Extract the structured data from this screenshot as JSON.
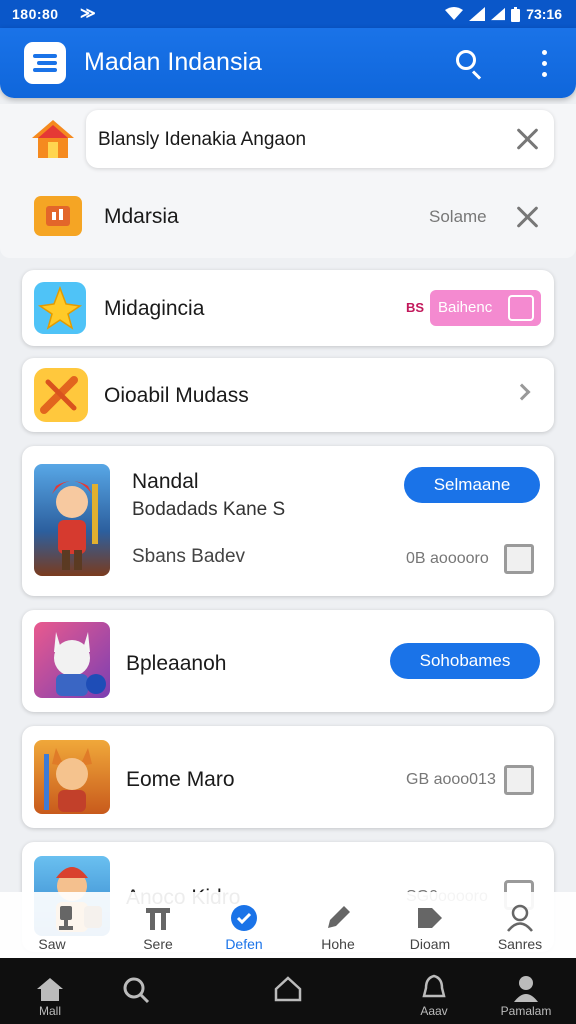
{
  "status_bar": {
    "time_left": "180:80",
    "time_right": "73:16"
  },
  "app_bar": {
    "title": "Madan Indansia"
  },
  "search_row": {
    "value": "Blansly  Idenakia Angaon"
  },
  "menu_rows": [
    {
      "label": "Mdarsia",
      "meta": "Solame"
    },
    {
      "label": "Midagincia",
      "badge_text": "Baihenc",
      "badge_prefix": "BS"
    },
    {
      "label": "Oioabil Mudass"
    }
  ],
  "game_cards": [
    {
      "title": "Nandal",
      "subtitle": "Bodadads Kane S",
      "extra": "Sbans Badev",
      "button": "Selmaane",
      "meta": "0B aooooro"
    },
    {
      "title": "Bpleaanoh",
      "button": "Sohobames"
    },
    {
      "title": "Eome Maro",
      "meta": "GB aooo013"
    },
    {
      "title": "Anoco Kidro",
      "meta": "SG0ooooro"
    }
  ],
  "bottom_tabs": [
    {
      "label": "Saw",
      "icon": "trophy-icon"
    },
    {
      "label": "Sere",
      "icon": "tools-icon"
    },
    {
      "label": "Defen",
      "icon": "check-badge-icon"
    },
    {
      "label": "Hohe",
      "icon": "pencil-icon"
    },
    {
      "label": "Dioam",
      "icon": "tag-icon"
    },
    {
      "label": "Sanres",
      "icon": "person-icon"
    }
  ],
  "nav_bar": [
    {
      "label": "Mall",
      "icon": "home-icon"
    },
    {
      "label": "",
      "icon": "search-icon"
    },
    {
      "label": "",
      "icon": "home-outline-icon"
    },
    {
      "label": "Aaav",
      "icon": "bell-icon"
    },
    {
      "label": "Pamalam",
      "icon": "person-icon"
    }
  ],
  "colors": {
    "accent": "#1a73e8",
    "pink_badge": "#f48ad0",
    "nav_bg": "#0f0f0f"
  }
}
